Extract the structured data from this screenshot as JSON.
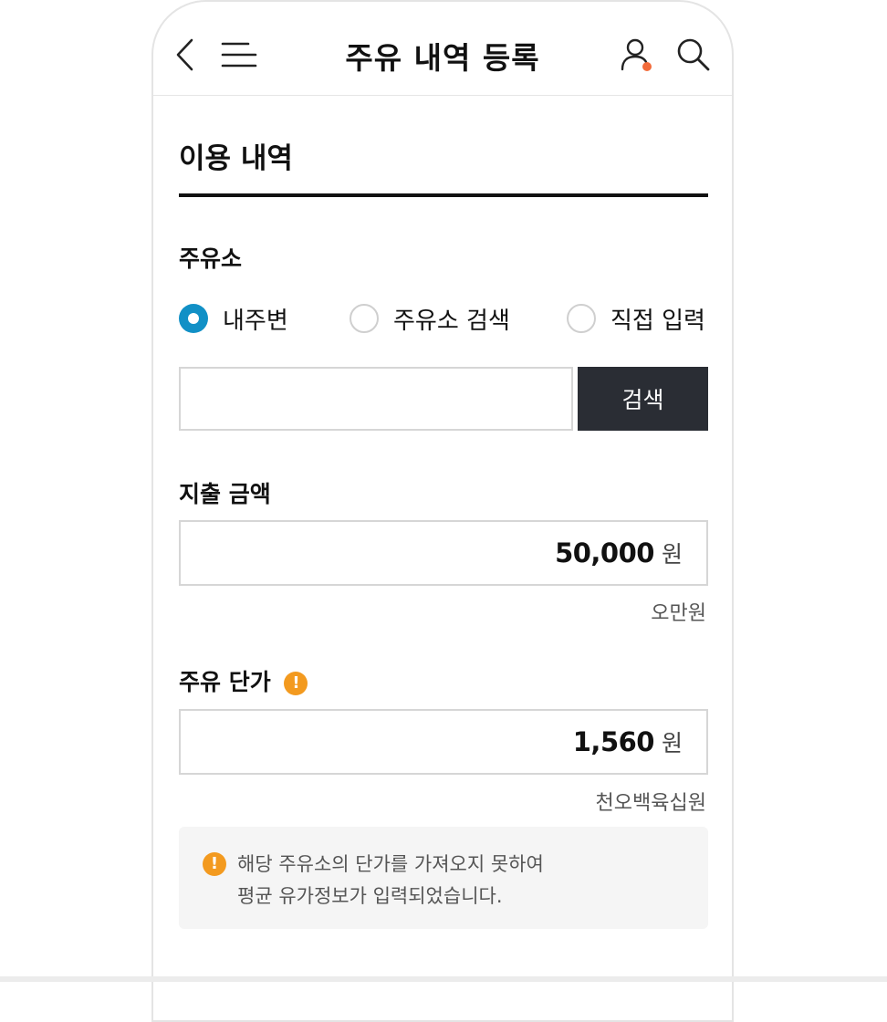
{
  "header": {
    "title": "주유 내역 등록",
    "icons": [
      "back-icon",
      "menu-icon",
      "user-icon",
      "search-icon"
    ],
    "notification_dot_color": "#f26b3a"
  },
  "section": {
    "title": "이용 내역"
  },
  "station": {
    "label": "주유소",
    "options": [
      {
        "label": "내주변",
        "selected": true
      },
      {
        "label": "주유소 검색",
        "selected": false
      },
      {
        "label": "직접 입력",
        "selected": false
      }
    ],
    "search_value": "",
    "search_button": "검색"
  },
  "expense": {
    "label": "지출 금액",
    "value": "50,000",
    "unit": "원",
    "helper": "오만원"
  },
  "price": {
    "label": "주유 단가",
    "value": "1,560",
    "unit": "원",
    "helper": "천오백육십원"
  },
  "notice": {
    "line1": "해당 주유소의 단가를 가져오지 못하여",
    "line2": "평균 유가정보가 입력되었습니다."
  },
  "colors": {
    "accent": "#1190c6",
    "button_dark": "#2a2d34",
    "warning": "#f39a1f"
  }
}
